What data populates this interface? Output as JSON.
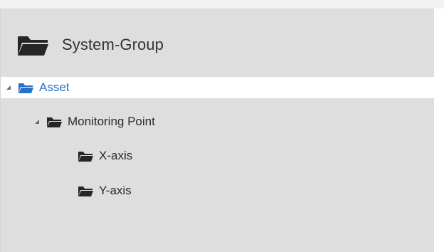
{
  "panel": {
    "title": "System-Group",
    "title_icon": "folder-open-icon"
  },
  "tree": {
    "asset": {
      "label": "Asset",
      "icon": "folder-open-icon",
      "selected": true,
      "expanded": true
    },
    "monitoring_point": {
      "label": "Monitoring Point",
      "icon": "folder-open-icon",
      "expanded": true
    },
    "x_axis": {
      "label": "X-axis",
      "icon": "folder-open-icon"
    },
    "y_axis": {
      "label": "Y-axis",
      "icon": "folder-open-icon"
    }
  },
  "colors": {
    "panel_bg": "#dedede",
    "selected_bg": "#ffffff",
    "selected_text": "#2a72c6",
    "selected_icon": "#2a72c6",
    "text": "#2b2b2b",
    "icon": "#262626"
  }
}
